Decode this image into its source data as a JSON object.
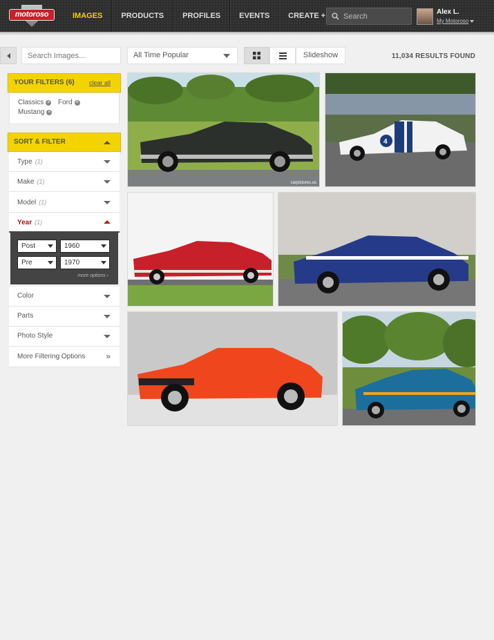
{
  "header": {
    "logo_text": "motoroso",
    "nav": [
      {
        "label": "IMAGES",
        "active": true
      },
      {
        "label": "PRODUCTS",
        "active": false
      },
      {
        "label": "PROFILES",
        "active": false
      },
      {
        "label": "EVENTS",
        "active": false
      },
      {
        "label": "CREATE +",
        "active": false
      }
    ],
    "search_placeholder": "Search",
    "user": {
      "name": "Alex L.",
      "link": "My Motoroso"
    }
  },
  "toolbar": {
    "search_placeholder": "Search Images...",
    "sort_value": "All Time Popular",
    "slideshow_label": "Slideshow",
    "results": "11,034 RESULTS FOUND"
  },
  "filters": {
    "title": "YOUR FILTERS (6)",
    "clear_label": "clear all",
    "chips": [
      "Classics",
      "Ford",
      "Mustang"
    ]
  },
  "sort_filter": {
    "title": "SORT & FILTER",
    "rows": [
      {
        "label": "Type",
        "count": "(1)"
      },
      {
        "label": "Make",
        "count": "(1)"
      },
      {
        "label": "Model",
        "count": "(1)"
      },
      {
        "label": "Year",
        "count": "(1)"
      }
    ],
    "year": {
      "row1": {
        "qualifier": "Post",
        "value": "1960"
      },
      "row2": {
        "qualifier": "Pre",
        "value": "1970"
      },
      "more_options": "more options ›"
    },
    "rows_after": [
      {
        "label": "Color"
      },
      {
        "label": "Parts"
      },
      {
        "label": "Photo Style"
      },
      {
        "label": "More Filtering Options"
      }
    ]
  },
  "photos": {
    "watermark": "carpictures.us",
    "cars": [
      {
        "color": "#2b302d",
        "bg": "#8fae4a"
      },
      {
        "color": "#f2f2f2",
        "bg": "#5b6e47",
        "stripe": "#1c3d7a",
        "number": "4"
      },
      {
        "color": "#c8202a",
        "bg": "#7aa742"
      },
      {
        "color": "#253b8a",
        "bg": "#6f8a48",
        "stripe": "#ffffff"
      },
      {
        "color": "#f0461e",
        "bg": "#c9c9c9"
      },
      {
        "color": "#1c6f9c",
        "bg": "#6f8e3d",
        "stripe": "#f3a21b"
      }
    ]
  }
}
